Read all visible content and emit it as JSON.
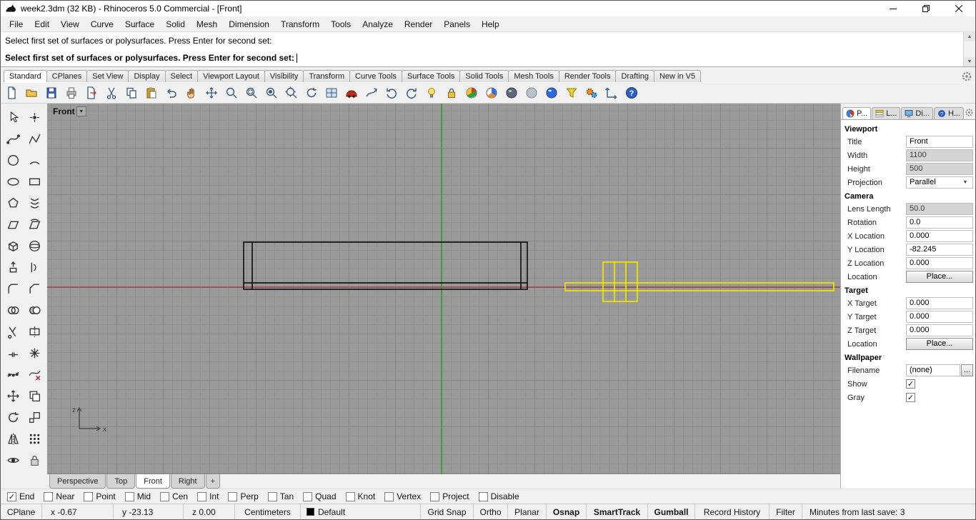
{
  "colors": {
    "canvas_bg": "#9a9a9a",
    "grid_minor": "#8f8f8f",
    "grid_major": "#858585",
    "axis_x": "#a04040",
    "axis_z": "#1fa01f",
    "object": "#141414",
    "selected": "#f0e400"
  },
  "window": {
    "title": "week2.3dm (32 KB) - Rhinoceros 5.0 Commercial - [Front]",
    "control_icons": [
      "minimize-icon",
      "restore-icon",
      "close-icon"
    ]
  },
  "menubar": {
    "items": [
      "File",
      "Edit",
      "View",
      "Curve",
      "Surface",
      "Solid",
      "Mesh",
      "Dimension",
      "Transform",
      "Tools",
      "Analyze",
      "Render",
      "Panels",
      "Help"
    ]
  },
  "command": {
    "history": "Select first set of surfaces or polysurfaces. Press Enter for second set:",
    "prompt": "Select first set of surfaces or polysurfaces. Press Enter for second set:"
  },
  "toolbar_tabs": {
    "tabs": [
      {
        "label": "Standard",
        "active": true
      },
      {
        "label": "CPlanes"
      },
      {
        "label": "Set View"
      },
      {
        "label": "Display"
      },
      {
        "label": "Select"
      },
      {
        "label": "Viewport Layout"
      },
      {
        "label": "Visibility"
      },
      {
        "label": "Transform"
      },
      {
        "label": "Curve Tools"
      },
      {
        "label": "Surface Tools"
      },
      {
        "label": "Solid Tools"
      },
      {
        "label": "Mesh Tools"
      },
      {
        "label": "Render Tools"
      },
      {
        "label": "Drafting"
      },
      {
        "label": "New in V5"
      }
    ]
  },
  "toolbar_icons": [
    "new-file",
    "open-file",
    "save",
    "print",
    "export",
    "cut",
    "copy",
    "paste",
    "undo",
    "pan",
    "move-view",
    "zoom-dynamic",
    "zoom-window",
    "zoom-selected",
    "zoom-extents",
    "rotate-view",
    "viewport-layout",
    "car",
    "orient-curve",
    "undo-view",
    "redo-view",
    "lightbulb",
    "lock",
    "render",
    "render-preview",
    "shaded-display",
    "ghosted-display",
    "rendered-display",
    "selection-filter",
    "options-gears",
    "cplane-axes",
    "help"
  ],
  "sidebar_icons": [
    "select",
    "points",
    "curve",
    "polyline",
    "circle",
    "arc",
    "ellipse",
    "rectangle",
    "polygon",
    "helix",
    "surface",
    "sweep",
    "box",
    "sphere",
    "extrude",
    "revolve",
    "fillet",
    "chamfer",
    "boolean-union",
    "boolean-difference",
    "trim",
    "split",
    "join",
    "explode",
    "show-points",
    "points-off",
    "move",
    "copy-object",
    "rotate",
    "scale",
    "mirror",
    "array",
    "hide",
    "lock-object"
  ],
  "viewport": {
    "title": "Front",
    "axis": {
      "x": "x",
      "z": "z"
    },
    "tabs": [
      {
        "label": "Perspective"
      },
      {
        "label": "Top"
      },
      {
        "label": "Front",
        "active": true
      },
      {
        "label": "Right"
      }
    ],
    "add_tab": "+"
  },
  "panel": {
    "tabs": [
      {
        "label": "P...",
        "active": true
      },
      {
        "label": "L..."
      },
      {
        "label": "Di..."
      },
      {
        "label": "H..."
      }
    ],
    "tab_icons": [
      "properties-tab-icon",
      "layers-tab-icon",
      "display-tab-icon",
      "help-tab-icon"
    ],
    "viewport_section": {
      "header": "Viewport",
      "rows": [
        {
          "label": "Title",
          "value": "Front"
        },
        {
          "label": "Width",
          "value": "1100",
          "disabled": true
        },
        {
          "label": "Height",
          "value": "500",
          "disabled": true
        },
        {
          "label": "Projection",
          "value": "Parallel",
          "control": "dropdown"
        }
      ]
    },
    "camera_section": {
      "header": "Camera",
      "rows": [
        {
          "label": "Lens Length",
          "value": "50.0",
          "disabled": true
        },
        {
          "label": "Rotation",
          "value": "0.0"
        },
        {
          "label": "X Location",
          "value": "0.000"
        },
        {
          "label": "Y Location",
          "value": "-82.245"
        },
        {
          "label": "Z Location",
          "value": "0.000"
        },
        {
          "label": "Location",
          "value": "Place..."
        }
      ]
    },
    "target_section": {
      "header": "Target",
      "rows": [
        {
          "label": "X Target",
          "value": "0.000"
        },
        {
          "label": "Y Target",
          "value": "0.000"
        },
        {
          "label": "Z Target",
          "value": "0.000"
        },
        {
          "label": "Location",
          "value": "Place..."
        }
      ]
    },
    "wallpaper_section": {
      "header": "Wallpaper",
      "rows": [
        {
          "label": "Filename",
          "value": "(none)",
          "button": "..."
        },
        {
          "label": "Show",
          "checked": true
        },
        {
          "label": "Gray",
          "checked": true
        }
      ]
    }
  },
  "osnap": {
    "items": [
      {
        "label": "End",
        "checked": true
      },
      {
        "label": "Near",
        "checked": false
      },
      {
        "label": "Point",
        "checked": false
      },
      {
        "label": "Mid",
        "checked": false
      },
      {
        "label": "Cen",
        "checked": false
      },
      {
        "label": "Int",
        "checked": false
      },
      {
        "label": "Perp",
        "checked": false
      },
      {
        "label": "Tan",
        "checked": false
      },
      {
        "label": "Quad",
        "checked": false
      },
      {
        "label": "Knot",
        "checked": false
      },
      {
        "label": "Vertex",
        "checked": false
      },
      {
        "label": "Project",
        "checked": false
      },
      {
        "label": "Disable",
        "checked": false
      }
    ]
  },
  "statusbar": {
    "cplane": "CPlane",
    "x": "x -0.67",
    "y": "y -23.13",
    "z": "z 0.00",
    "units": "Centimeters",
    "layer": "Default",
    "panes": [
      {
        "label": "Grid Snap"
      },
      {
        "label": "Ortho"
      },
      {
        "label": "Planar"
      },
      {
        "label": "Osnap",
        "active": true
      },
      {
        "label": "SmartTrack",
        "active": true
      },
      {
        "label": "Gumball",
        "active": true
      },
      {
        "label": "Record History"
      },
      {
        "label": "Filter"
      }
    ],
    "last_save": "Minutes from last save: 3"
  }
}
